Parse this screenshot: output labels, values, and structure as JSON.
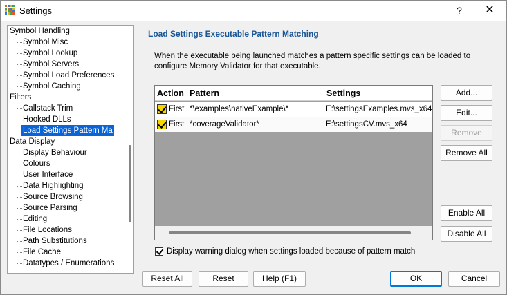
{
  "window": {
    "title": "Settings",
    "help_glyph": "?",
    "close_glyph": "✕"
  },
  "tree": {
    "items": [
      {
        "label": "Symbol Handling",
        "level": 0
      },
      {
        "label": "Symbol Misc",
        "level": 1
      },
      {
        "label": "Symbol Lookup",
        "level": 1
      },
      {
        "label": "Symbol Servers",
        "level": 1
      },
      {
        "label": "Symbol Load Preferences",
        "level": 1
      },
      {
        "label": "Symbol Caching",
        "level": 1
      },
      {
        "label": "Filters",
        "level": 0
      },
      {
        "label": "Callstack Trim",
        "level": 1
      },
      {
        "label": "Hooked DLLs",
        "level": 1
      },
      {
        "label": "Load Settings Pattern Ma",
        "level": 1,
        "selected": true
      },
      {
        "label": "Data Display",
        "level": 0
      },
      {
        "label": "Display Behaviour",
        "level": 1
      },
      {
        "label": "Colours",
        "level": 1
      },
      {
        "label": "User Interface",
        "level": 1
      },
      {
        "label": "Data Highlighting",
        "level": 1
      },
      {
        "label": "Source Browsing",
        "level": 1
      },
      {
        "label": "Source Parsing",
        "level": 1
      },
      {
        "label": "Editing",
        "level": 1
      },
      {
        "label": "File Locations",
        "level": 1
      },
      {
        "label": "Path Substitutions",
        "level": 1
      },
      {
        "label": "File Cache",
        "level": 1
      },
      {
        "label": "Datatypes / Enumerations",
        "level": 1
      }
    ]
  },
  "page": {
    "heading": "Load Settings Executable Pattern Matching",
    "description": "When the executable being launched matches a pattern specific settings can be loaded to configure Memory Validator for that executable."
  },
  "table": {
    "columns": [
      "Action",
      "Pattern",
      "Settings"
    ],
    "rows": [
      {
        "checked": true,
        "action": "First",
        "pattern": "*\\examples\\nativeExample\\*",
        "settings": "E:\\settingsExamples.mvs_x64"
      },
      {
        "checked": true,
        "action": "First",
        "pattern": "*coverageValidator*",
        "settings": "E:\\settingsCV.mvs_x64"
      }
    ]
  },
  "side_buttons": {
    "add": "Add...",
    "edit": "Edit...",
    "remove": "Remove",
    "remove_all": "Remove All",
    "enable_all": "Enable All",
    "disable_all": "Disable All"
  },
  "option": {
    "checked": true,
    "label": "Display warning dialog when settings loaded because of pattern match"
  },
  "footer": {
    "reset_all": "Reset All",
    "reset": "Reset",
    "help": "Help (F1)",
    "ok": "OK",
    "cancel": "Cancel"
  },
  "colors": {
    "selection": "#0a64d8",
    "heading": "#1a5596",
    "checkbox_fill": "#f5d400",
    "list_background": "#a0a0a0"
  }
}
